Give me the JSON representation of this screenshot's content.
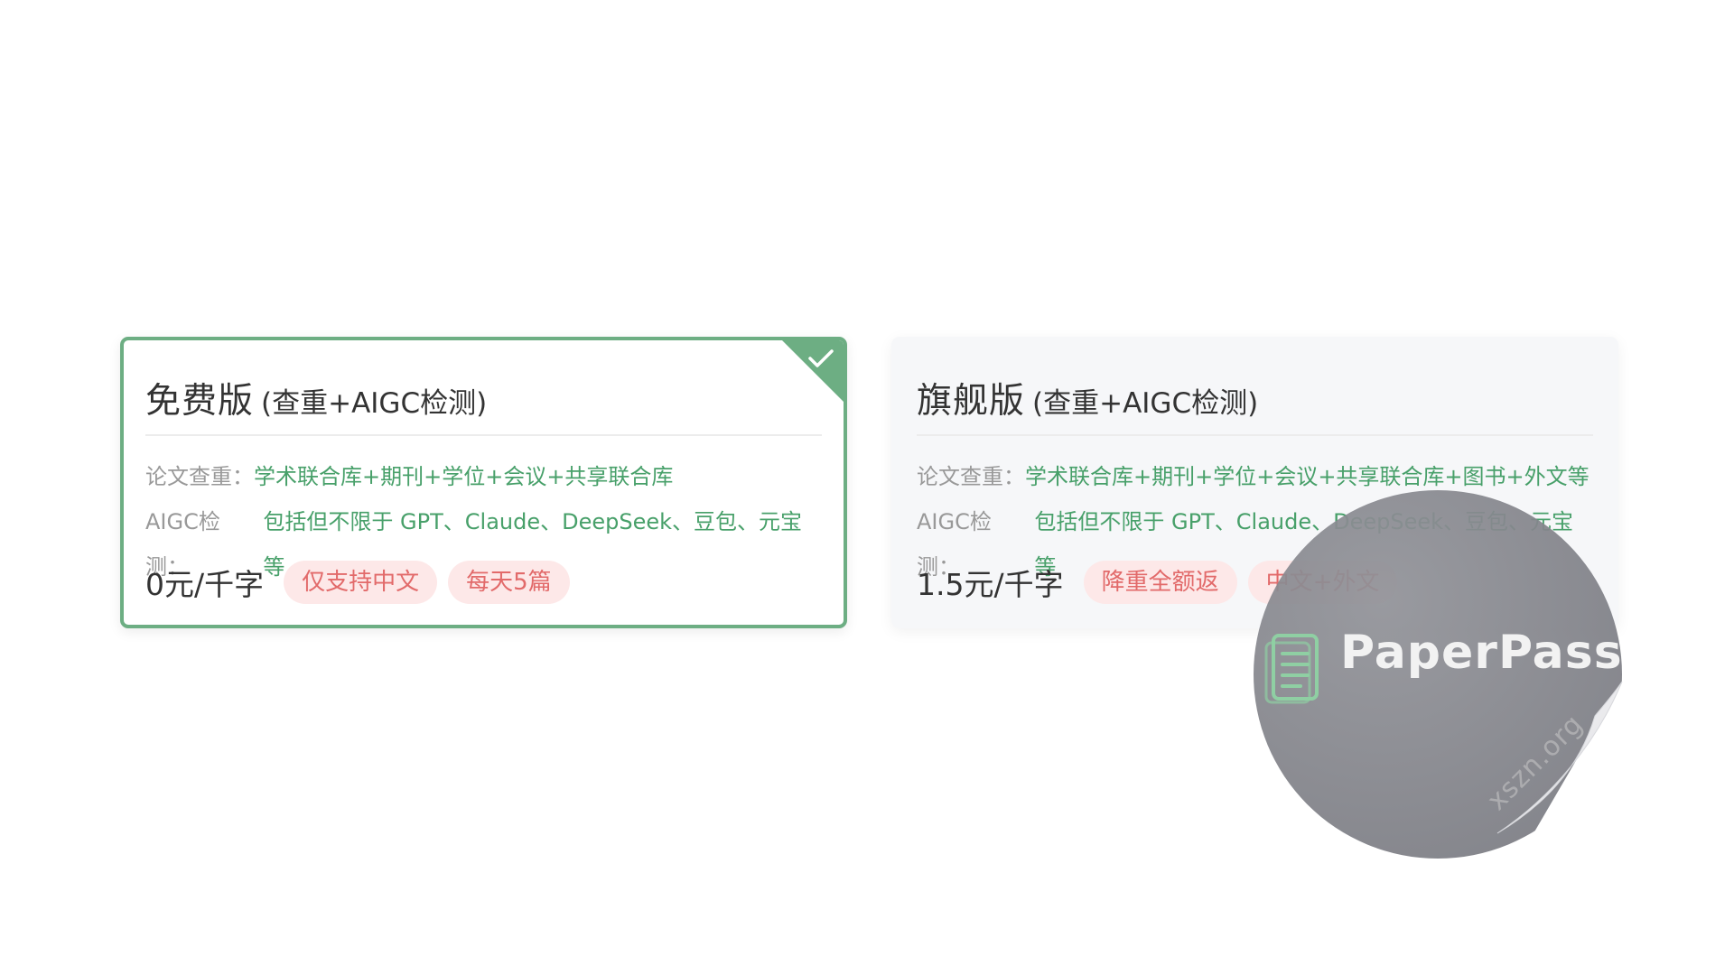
{
  "plans": [
    {
      "title": "免费版",
      "subtitle": "(查重+AIGC检测)",
      "line1_label": "论文查重：",
      "line1_value": "学术联合库+期刊+学位+会议+共享联合库",
      "line2_label": "AIGC检测：",
      "line2_value": "包括但不限于 GPT、Claude、DeepSeek、豆包、元宝等",
      "price": "0元/千字",
      "tags": [
        "仅支持中文",
        "每天5篇"
      ],
      "selected": true
    },
    {
      "title": "旗舰版",
      "subtitle": "(查重+AIGC检测)",
      "line1_label": "论文查重：",
      "line1_value": "学术联合库+期刊+学位+会议+共享联合库+图书+外文等",
      "line2_label": "AIGC检测：",
      "line2_value": "包括但不限于 GPT、Claude、DeepSeek、豆包、元宝等",
      "price": "1.5元/千字",
      "tags": [
        "降重全额返",
        "中文+外文"
      ],
      "selected": false
    }
  ],
  "sticker": {
    "brand": "PaperPass",
    "icon": "document-clipboard-icon"
  },
  "watermark": "xszn.org",
  "colors": {
    "accent_green": "#6dae83",
    "value_green": "#48a06a",
    "tag_bg": "#fde8e8",
    "tag_text": "#e26a6a"
  }
}
